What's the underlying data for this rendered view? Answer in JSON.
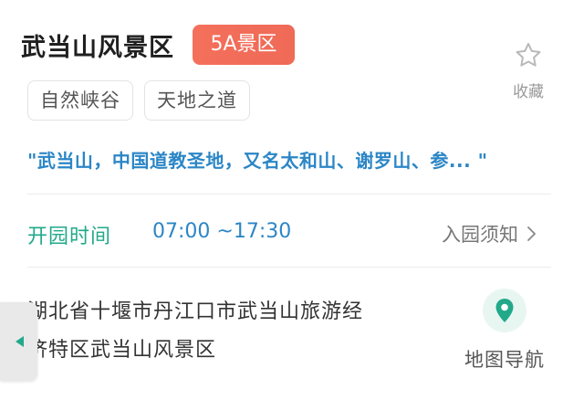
{
  "scenic": {
    "title": "武当山风景区",
    "level_badge": "5A景区",
    "tags": [
      "自然峡谷",
      "天地之道"
    ],
    "quote": "\"武当山，中国道教圣地，又名太和山、谢罗山、参... \""
  },
  "favorite": {
    "label": "收藏",
    "icon": "star-outline-icon"
  },
  "hours": {
    "label": "开园时间",
    "value": "07:00 ~17:30"
  },
  "notice": {
    "label": "入园须知",
    "icon": "chevron-right-icon"
  },
  "address": {
    "line1": "湖北省十堰市丹江口市武当山旅游经",
    "line2": "济特区武当山风景区"
  },
  "map": {
    "label": "地图导航",
    "icon": "map-pin-icon"
  },
  "side_handle": {
    "icon": "triangle-left-icon"
  },
  "colors": {
    "badge": "#f06b57",
    "accent_green": "#21a98a",
    "accent_blue": "#2b86c6",
    "text_dark": "#1f1f1f",
    "text_gray": "#777777"
  }
}
